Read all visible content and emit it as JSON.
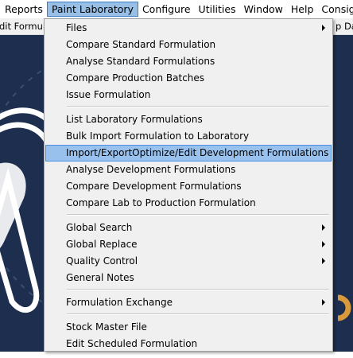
{
  "menubar": {
    "items": [
      {
        "label": "Reports"
      },
      {
        "label": "Paint Laboratory"
      },
      {
        "label": "Configure"
      },
      {
        "label": "Utilities"
      },
      {
        "label": "Window"
      },
      {
        "label": "Help"
      },
      {
        "label": "Consignment"
      }
    ]
  },
  "toolbar": {
    "left_text": "dit Formula",
    "right_text": "p Da"
  },
  "menu": {
    "items": [
      {
        "label": "Files",
        "submenu": true
      },
      {
        "label": "Compare Standard Formulation"
      },
      {
        "label": "Analyse Standard Formulations"
      },
      {
        "label": "Compare Production Batches"
      },
      {
        "label": "Issue Formulation"
      },
      {
        "label": "List Laboratory Formulations"
      },
      {
        "label": "Bulk Import Formulation to Laboratory"
      },
      {
        "label": "Import/ExportOptimize/Edit Development Formulations",
        "highlighted": true
      },
      {
        "label": "Analyse Development Formulations"
      },
      {
        "label": "Compare Development Formulations"
      },
      {
        "label": "Compare Lab to Production Formulation"
      },
      {
        "label": "Global Search",
        "submenu": true
      },
      {
        "label": "Global Replace",
        "submenu": true
      },
      {
        "label": "Quality Control",
        "submenu": true
      },
      {
        "label": "General Notes"
      },
      {
        "label": "Formulation Exchange",
        "submenu": true
      },
      {
        "label": "Stock Master File"
      },
      {
        "label": "Edit Scheduled Formulation"
      }
    ]
  },
  "colors": {
    "background": "#1e2e4e",
    "highlight": "#99c1ee",
    "accent_orange": "#d89a3a"
  }
}
